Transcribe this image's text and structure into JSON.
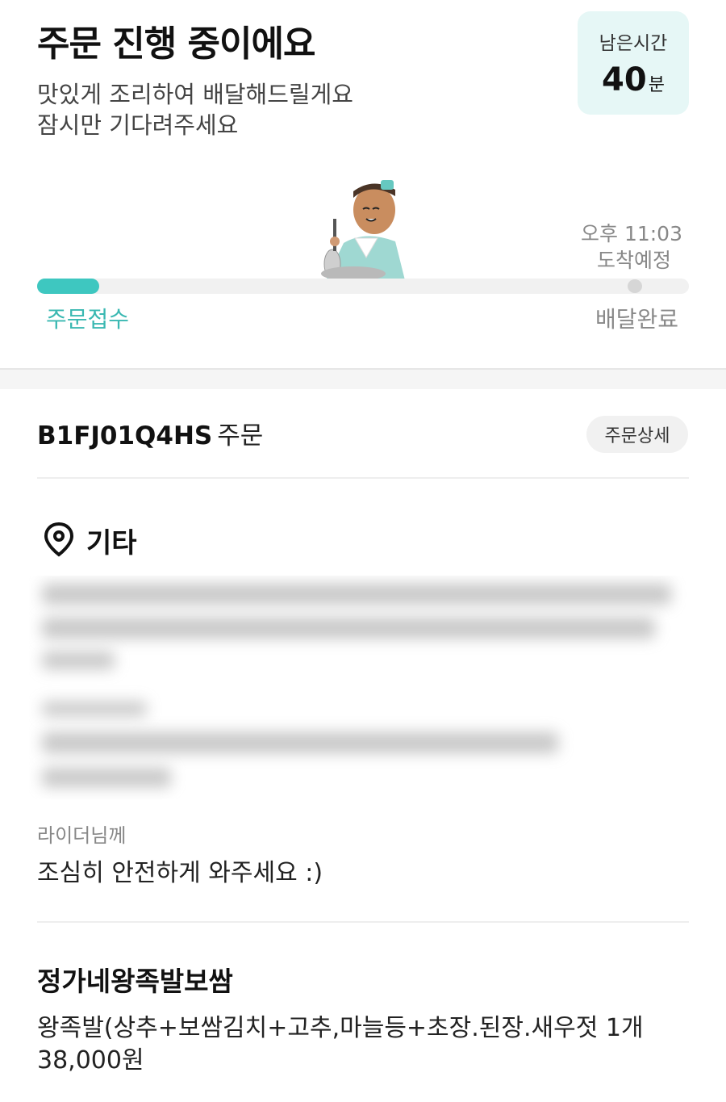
{
  "header": {
    "title": "주문 진행 중이에요",
    "subtitle_line1": "맛있게 조리하여 배달해드릴게요",
    "subtitle_line2": "잠시만 기다려주세요"
  },
  "remaining": {
    "label": "남은시간",
    "value": "40",
    "unit": "분"
  },
  "progress": {
    "eta_time": "오후 11:03",
    "eta_label": "도착예정",
    "step_start": "주문접수",
    "step_end": "배달완료",
    "progress_fraction": 0.08,
    "accent_color": "#3ec7c0"
  },
  "order": {
    "id": "B1FJ01Q4HS",
    "suffix": "주문",
    "detail_button": "주문상세"
  },
  "address": {
    "icon": "location-pin-icon",
    "type": "기타"
  },
  "rider": {
    "label": "라이더님께",
    "message": "조심히 안전하게 와주세요 :)"
  },
  "store": {
    "name": "정가네왕족발보쌈",
    "item": "왕족발(상추+보쌈김치+고추,마늘등+초장.된장.새우젓 1개",
    "price": "38,000원"
  }
}
